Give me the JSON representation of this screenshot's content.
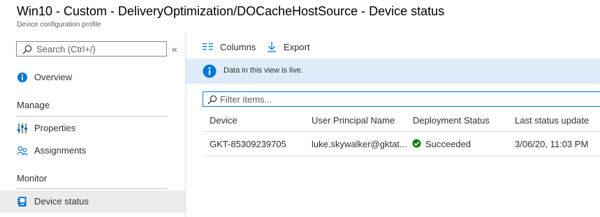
{
  "header": {
    "title": "Win10 - Custom - DeliveryOptimization/DOCacheHostSource - Device status",
    "subtitle": "Device configuration profile"
  },
  "sidebar": {
    "search_placeholder": "Search (Ctrl+/)",
    "collapse_glyph": "«",
    "items": [
      {
        "label": "Overview",
        "icon": "info-icon"
      },
      {
        "label": "Properties",
        "icon": "properties-icon"
      },
      {
        "label": "Assignments",
        "icon": "assignments-icon"
      },
      {
        "label": "Device status",
        "icon": "device-status-icon",
        "active": true
      }
    ],
    "sections": {
      "manage": "Manage",
      "monitor": "Monitor"
    }
  },
  "toolbar": {
    "columns_label": "Columns",
    "export_label": "Export"
  },
  "banner": {
    "message": "Data in this view is live.",
    "icon": "info-icon"
  },
  "filter": {
    "placeholder": "Filter items..."
  },
  "table": {
    "columns": [
      "Device",
      "User Principal Name",
      "Deployment Status",
      "Last status update"
    ],
    "rows": [
      {
        "device": "GKT-85309239705",
        "upn": "luke.skywalker@gktat...",
        "status": "Succeeded",
        "last_update": "3/06/20, 11:03 PM"
      }
    ]
  },
  "colors": {
    "accent": "#0078d4",
    "banner_bg": "#deecf9",
    "success": "#107c10",
    "active_nav_bg": "#edebe9"
  }
}
